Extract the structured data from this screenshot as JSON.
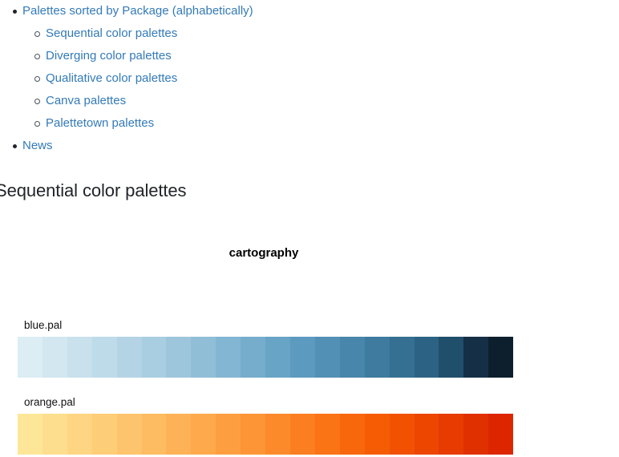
{
  "nav": {
    "items": [
      {
        "label": "Palettes sorted by Package (alphabetically)",
        "children": [
          {
            "label": "Sequential color palettes"
          },
          {
            "label": "Diverging color palettes"
          },
          {
            "label": "Qualitative color palettes"
          },
          {
            "label": "Canva palettes"
          },
          {
            "label": "Palettetown palettes"
          }
        ]
      },
      {
        "label": "News",
        "children": []
      }
    ]
  },
  "section": {
    "heading": "Sequential color palettes"
  },
  "figure": {
    "title": "cartography",
    "palettes": [
      {
        "name": "blue.pal",
        "colors": [
          "#dcedf4",
          "#d2e7f0",
          "#c8e1ed",
          "#bedbe9",
          "#b4d4e5",
          "#a9cde1",
          "#9dc6dc",
          "#90bed7",
          "#83b6d2",
          "#76adcc",
          "#68a4c5",
          "#5d9ac0",
          "#5390b6",
          "#4986ab",
          "#3f7b9f",
          "#357092",
          "#2c6384",
          "#1f4f6b",
          "#152f46",
          "#0d1f2d"
        ]
      },
      {
        "name": "orange.pal",
        "colors": [
          "#fee699",
          "#fdde8e",
          "#fdd583",
          "#fdcd78",
          "#fdc46d",
          "#fdbb62",
          "#fdb257",
          "#fda94c",
          "#fd9f41",
          "#fd9436",
          "#fc8a2b",
          "#fb7e20",
          "#fa7315",
          "#f8670b",
          "#f65c04",
          "#f25102",
          "#ed4601",
          "#e73b01",
          "#e13000",
          "#dd2600"
        ]
      }
    ]
  },
  "colors": {
    "link": "#337ab7",
    "text": "#212529",
    "background": "#ffffff"
  }
}
